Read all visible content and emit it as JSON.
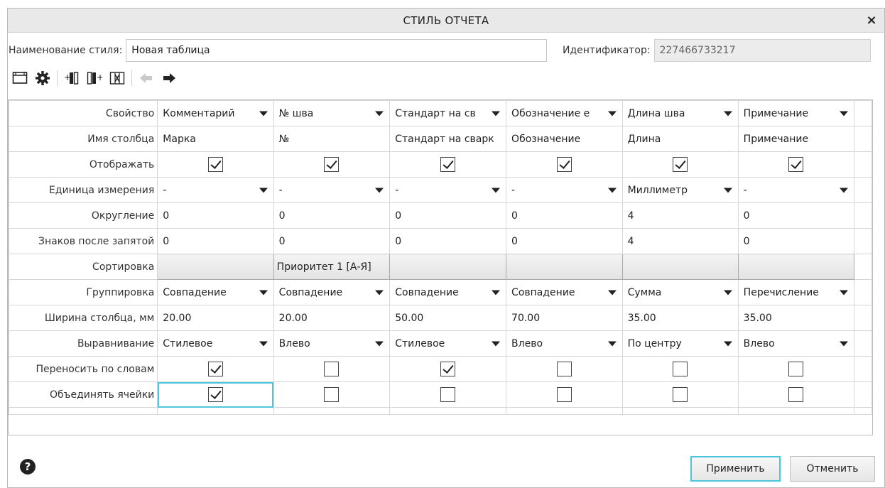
{
  "window": {
    "title": "СТИЛЬ ОТЧЕТА",
    "close_glyph": "×"
  },
  "style_name": {
    "label": "Наименование стиля:",
    "value": "Новая таблица"
  },
  "identifier": {
    "label": "Идентификатор:",
    "value": "227466733217"
  },
  "toolbar": {
    "icons": [
      "table-icon",
      "gear-icon",
      "insert-column-before-icon",
      "insert-column-after-icon",
      "delete-column-icon",
      "move-left-arrow-icon",
      "move-right-arrow-icon"
    ]
  },
  "grid": {
    "row_labels": {
      "property": "Свойство",
      "column_name": "Имя столбца",
      "display": "Отображать",
      "unit": "Единица измерения",
      "rounding": "Округление",
      "decimals": "Знаков после запятой",
      "sorting": "Сортировка",
      "grouping": "Группировка",
      "width": "Ширина столбца, мм",
      "alignment": "Выравнивание",
      "wrap": "Переносить по словам",
      "merge": "Объединять ячейки"
    },
    "columns": [
      {
        "property": "Комментарий",
        "name": "Марка",
        "display": true,
        "unit": "-",
        "rounding": "0",
        "decimals": "0",
        "sorting": "",
        "grouping": "Совпадение",
        "width": "20.00",
        "alignment": "Стилевое",
        "wrap": true,
        "merge": true
      },
      {
        "property": "№ шва",
        "name": "№",
        "display": true,
        "unit": "-",
        "rounding": "0",
        "decimals": "0",
        "sorting": "Приоритет 1 [А-Я]",
        "grouping": "Совпадение",
        "width": "20.00",
        "alignment": "Влево",
        "wrap": false,
        "merge": false
      },
      {
        "property": "Стандарт на св",
        "name": "Стандарт на сварк",
        "display": true,
        "unit": "-",
        "rounding": "0",
        "decimals": "0",
        "sorting": "",
        "grouping": "Совпадение",
        "width": "50.00",
        "alignment": "Стилевое",
        "wrap": true,
        "merge": false
      },
      {
        "property": "Обозначение е",
        "name": "Обозначение",
        "display": true,
        "unit": "-",
        "rounding": "0",
        "decimals": "0",
        "sorting": "",
        "grouping": "Совпадение",
        "width": "70.00",
        "alignment": "Влево",
        "wrap": false,
        "merge": false
      },
      {
        "property": "Длина шва",
        "name": "Длина",
        "display": true,
        "unit": "Миллиметр",
        "rounding": "4",
        "decimals": "4",
        "sorting": "",
        "grouping": "Сумма",
        "width": "35.00",
        "alignment": "По центру",
        "wrap": false,
        "merge": false
      },
      {
        "property": "Примечание",
        "name": "Примечание",
        "display": true,
        "unit": "-",
        "rounding": "0",
        "decimals": "0",
        "sorting": "",
        "grouping": "Перечисление",
        "width": "35.00",
        "alignment": "Влево",
        "wrap": false,
        "merge": false
      }
    ]
  },
  "footer": {
    "apply_label": "Применить",
    "cancel_label": "Отменить",
    "help_glyph": "?"
  },
  "colors": {
    "accent": "#4dc6dd",
    "titlebar": "#e9e9e9"
  }
}
